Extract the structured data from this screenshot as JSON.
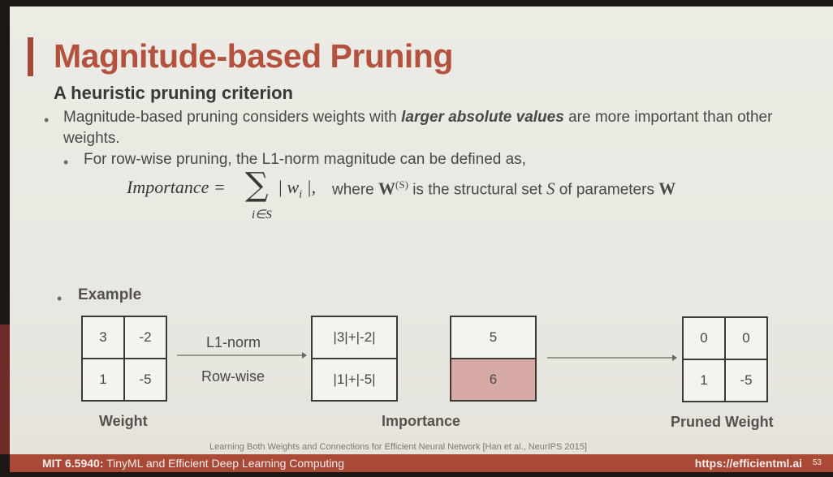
{
  "slide": {
    "title": "Magnitude-based Pruning",
    "subtitle": "A heuristic pruning criterion",
    "bullet1_pre": "Magnitude-based pruning considers weights with ",
    "bullet1_emph": "larger absolute values",
    "bullet1_post": " are more important than other weights.",
    "bullet2": "For row-wise pruning, the L1-norm magnitude can be defined as,",
    "formula": {
      "lhs": "Importance =",
      "sigma": "∑",
      "term": "| w",
      "term_sub": "i",
      "term_end": " |,",
      "subscript": "i∈S",
      "where_text": "where",
      "W": "W",
      "W_sup": "(S)",
      "is_text": "is the structural set",
      "S": "S",
      "of_text": "of parameters",
      "W2": "W"
    },
    "example_label": "Example",
    "weight_matrix": [
      "3",
      "-2",
      "1",
      "-5"
    ],
    "arrow_top": "L1-norm",
    "arrow_bottom": "Row-wise",
    "importance_expr": [
      "|3|+|-2|",
      "|1|+|-5|"
    ],
    "importance_values": [
      "5",
      "6"
    ],
    "pruned_matrix": [
      "0",
      "0",
      "1",
      "-5"
    ],
    "label_weight": "Weight",
    "label_importance": "Importance",
    "label_pruned": "Pruned Weight",
    "citation": "Learning Both Weights and Connections for Efficient Neural Network [Han et al., NeurIPS 2015]"
  },
  "footer": {
    "course": "MIT 6.5940:",
    "course_rest": " TinyML and Efficient Deep Learning Computing",
    "url": "https://efficientml.ai",
    "page": "53"
  },
  "colors": {
    "title": "#b3523f",
    "footer": "#a84a36",
    "highlight": "#d7aaa6"
  }
}
